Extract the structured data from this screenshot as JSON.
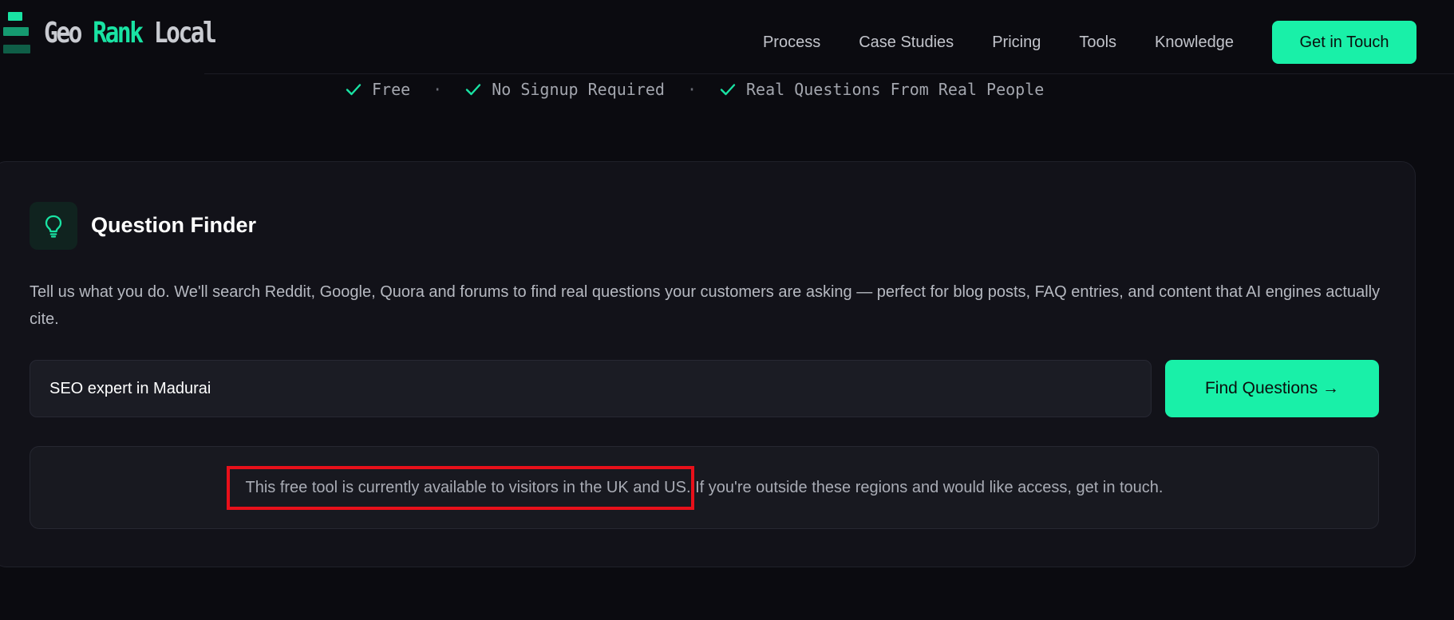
{
  "brand": {
    "word1": "Geo",
    "word2": "Rank",
    "word3": "Local"
  },
  "nav": {
    "items": [
      "Process",
      "Case Studies",
      "Pricing",
      "Tools",
      "Knowledge"
    ],
    "cta": "Get in Touch"
  },
  "features": {
    "items": [
      "Free",
      "No Signup Required",
      "Real Questions From Real People"
    ],
    "separator": "·"
  },
  "card": {
    "icon": "lightbulb-icon",
    "title": "Question Finder",
    "description": "Tell us what you do. We'll search Reddit, Google, Quora and forums to find real questions your customers are asking — perfect for blog posts, FAQ entries, and content that AI engines actually cite.",
    "search_value": "SEO expert in Madurai",
    "button_label": "Find Questions →",
    "notice_highlighted": "This free tool is currently available to visitors in the UK and US.",
    "notice_rest": " If you're outside these regions and would like access, get in touch."
  },
  "colors": {
    "accent": "#19f0a8",
    "background": "#0b0b10",
    "highlight_box": "#e8101a"
  }
}
